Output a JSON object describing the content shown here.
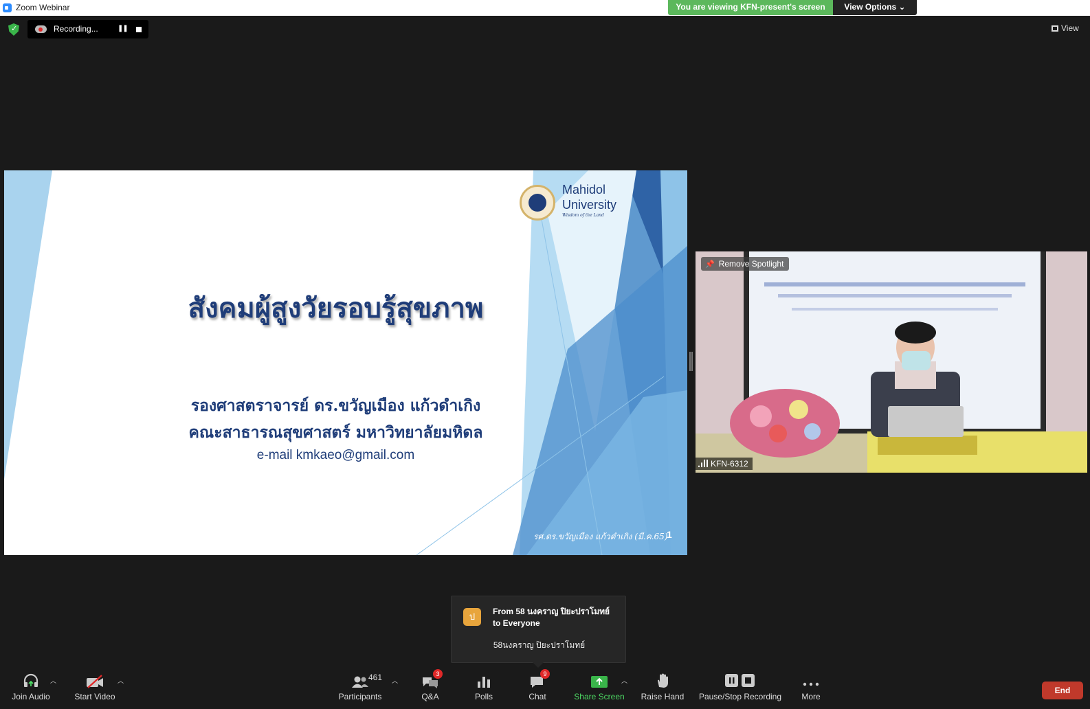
{
  "window": {
    "title": "Zoom Webinar"
  },
  "banner": {
    "viewing_text": "You are viewing KFN-present's screen",
    "view_options_label": "View Options ⌄"
  },
  "recording": {
    "label": "Recording..."
  },
  "view": {
    "label": "View"
  },
  "slide": {
    "title": "สังคมผู้สูงวัยรอบรู้สุขภาพ",
    "presenter": "รองศาสตราจารย์ ดร.ขวัญเมือง แก้วดำเกิง",
    "faculty": "คณะสาธารณสุขศาสตร์ มหาวิทยาลัยมหิดล",
    "email": "e-mail kmkaeo@gmail.com",
    "logo_name_line1": "Mahidol",
    "logo_name_line2": "University",
    "logo_tagline": "Wisdom of the Land",
    "footer": "รศ.ดร.ขวัญเมือง แก้วดำเกิง (มี.ค.65)",
    "page_number": "1"
  },
  "video": {
    "spotlight_label": "Remove Spotlight",
    "participant_name": "KFN-6312"
  },
  "chat_notification": {
    "avatar_letter": "ป",
    "from": "From 58 นงคราญ ปิยะปราโมทย์ to Everyone",
    "message": "58นงคราญ ปิยะปราโมทย์"
  },
  "toolbar": {
    "join_audio": "Join Audio",
    "start_video": "Start Video",
    "participants": "Participants",
    "participants_count": "461",
    "qa": "Q&A",
    "qa_badge": "3",
    "polls": "Polls",
    "chat": "Chat",
    "chat_badge": "9",
    "share_screen": "Share Screen",
    "raise_hand": "Raise Hand",
    "pause_stop_recording": "Pause/Stop Recording",
    "more": "More",
    "end": "End"
  },
  "colors": {
    "accent_green": "#5cb85c",
    "end_red": "#c0392b",
    "slide_text": "#1f3d79",
    "badge_red": "#e02828"
  }
}
